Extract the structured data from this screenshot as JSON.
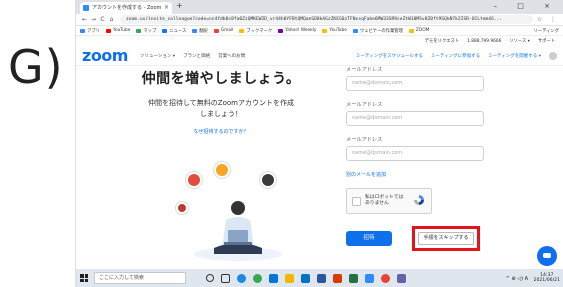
{
  "step_label": "G)",
  "browser": {
    "tab_title": "アカウントを作成する - Zoom",
    "tab_close": "×",
    "new_tab": "+",
    "window_controls": "– □ ×",
    "back": "←",
    "forward": "→",
    "reload": "C",
    "home": "⌂",
    "url": "zoom.us/invite_colleague?code=nc4fdb0c8fa0ZzQMKEW2D_vr44h0YFBtQMQaeSD8kAGzZKEG0zTFNxsqFabe6MW33SR9ceZtW10MSv8Z0ft9SQkN7k2ISR-OCLtem4G...",
    "url_icons": "☆ ⋮",
    "bookmarks": [
      "アプリ",
      "YouTube",
      "マップ",
      "ニュース",
      "翻訳",
      "Gmail",
      "ブックマーク",
      "Yahoo! Weekly",
      "YouTube",
      "ウェビナーの作業管理",
      "ZOOM"
    ],
    "bookmarks_right": "リーディング"
  },
  "zoom": {
    "top_links": [
      "デモをリクエスト",
      "1.888.799.9666",
      "リソース ▾",
      "サポート"
    ],
    "logo": "zoom",
    "nav_links": [
      "ソリューション ▾",
      "プランと価格",
      "営業へのお問"
    ],
    "nav_right": [
      "ミーティングをスケジュールする",
      "ミーティングに参加する",
      "ミーティングを開催する ▾"
    ],
    "headline": "仲間を増やしましょう。",
    "subtext_line1": "仲間を招待して無料のZoomアカウントを作成",
    "subtext_line2": "しましょう！",
    "sub_link": "なぜ招待するのですか？",
    "form": {
      "fields": [
        {
          "label": "メールアドレス",
          "placeholder": "name@domain.com"
        },
        {
          "label": "メールアドレス",
          "placeholder": "name@domain.com"
        },
        {
          "label": "メールアドレス",
          "placeholder": "name@domain.com"
        }
      ],
      "add_more": "別のメールを追加",
      "captcha_text": "私はロボットではありません",
      "invite_button": "招待",
      "skip_button": "手順をスキップする"
    }
  },
  "taskbar": {
    "search_placeholder": "ここに入力して検索",
    "time": "14:37",
    "date": "2021/06/21",
    "tray_icons": "^ ⊕ ◁) A"
  },
  "colors": {
    "zoom_blue": "#0e71eb",
    "highlight_red": "#e5121a"
  }
}
